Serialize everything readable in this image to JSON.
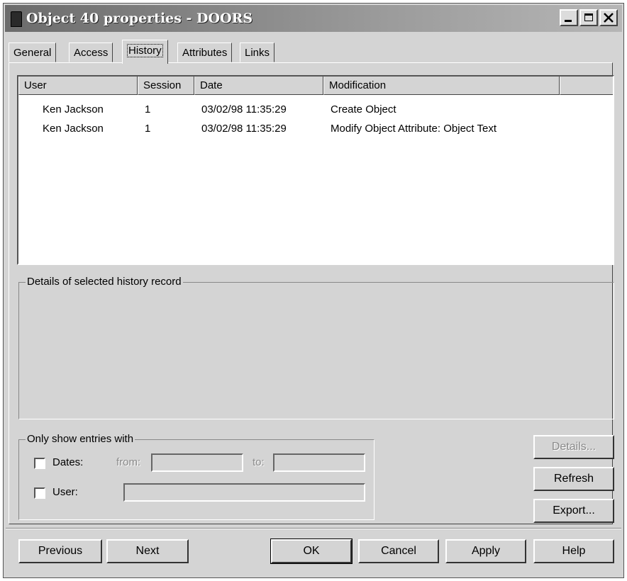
{
  "window": {
    "title": "Object 40 properties - DOORS"
  },
  "tabs": [
    {
      "label": "General"
    },
    {
      "label": "Access"
    },
    {
      "label": "History"
    },
    {
      "label": "Attributes"
    },
    {
      "label": "Links"
    }
  ],
  "active_tab": "History",
  "history_list": {
    "columns": [
      "User",
      "Session",
      "Date",
      "Modification"
    ],
    "rows": [
      {
        "user": "Ken Jackson",
        "session": "1",
        "date": "03/02/98 11:35:29",
        "modification": "Create Object"
      },
      {
        "user": "Ken Jackson",
        "session": "1",
        "date": "03/02/98 11:35:29",
        "modification": "Modify Object Attribute: Object Text"
      }
    ]
  },
  "details": {
    "label": "Details of selected history record"
  },
  "filter": {
    "label": "Only show entries with",
    "dates_label": "Dates:",
    "dates_checked": false,
    "from_label": "from:",
    "from_value": "",
    "to_label": "to:",
    "to_value": "",
    "user_label": "User:",
    "user_checked": false,
    "user_value": ""
  },
  "side_buttons": {
    "details": "Details...",
    "refresh": "Refresh",
    "export": "Export..."
  },
  "bottom_buttons": {
    "previous": "Previous",
    "next": "Next",
    "ok": "OK",
    "cancel": "Cancel",
    "apply": "Apply",
    "help": "Help"
  }
}
